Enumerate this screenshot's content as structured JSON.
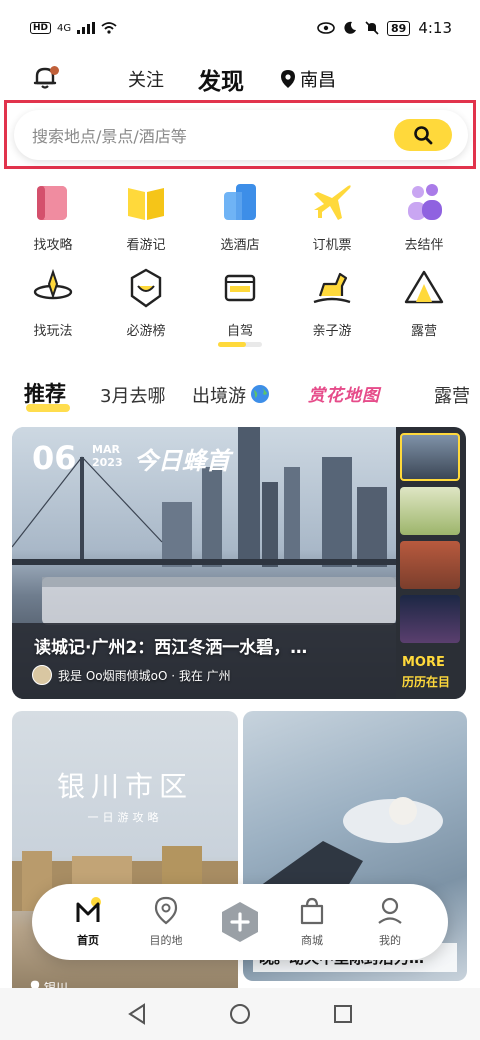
{
  "status_bar": {
    "left_label": "HD",
    "network": "4G",
    "battery": "89",
    "time": "4:13"
  },
  "header": {
    "tab_follow": "关注",
    "tab_discover": "发现",
    "location": "南昌"
  },
  "search": {
    "placeholder": "搜索地点/景点/酒店等"
  },
  "quick_entries": [
    {
      "label": "找攻略",
      "icon": "guide-book-icon"
    },
    {
      "label": "看游记",
      "icon": "travel-notes-icon"
    },
    {
      "label": "选酒店",
      "icon": "hotel-icon"
    },
    {
      "label": "订机票",
      "icon": "airplane-icon"
    },
    {
      "label": "去结伴",
      "icon": "companion-icon"
    },
    {
      "label": "找玩法",
      "icon": "play-icon"
    },
    {
      "label": "必游榜",
      "icon": "ranking-icon"
    },
    {
      "label": "自驾",
      "icon": "car-icon"
    },
    {
      "label": "亲子游",
      "icon": "rocking-horse-icon"
    },
    {
      "label": "露营",
      "icon": "tent-icon"
    }
  ],
  "category_tabs": [
    {
      "label": "推荐",
      "active": true
    },
    {
      "label": "3月去哪",
      "active": false
    },
    {
      "label": "出境游",
      "active": false
    },
    {
      "label": "赏花地图",
      "active": false
    },
    {
      "label": "露营",
      "active": false
    }
  ],
  "hero_card": {
    "day": "06",
    "month": "MAR",
    "year": "2023",
    "headline": "今日蜂首",
    "title": "读城记·广州2：西江冬洒一水碧，…",
    "author_line": "我是 Oo烟雨倾城oO · 我在 广州",
    "more_label": "MORE",
    "more_sub": "历历在目"
  },
  "card_left": {
    "title": "银川市区",
    "subtitle": "一日游攻略",
    "location": "银川"
  },
  "card_right": {
    "caption": "晚。动火中里际封冶力…"
  },
  "bottom_nav": [
    {
      "label": "首页",
      "icon": "home-icon",
      "active": true
    },
    {
      "label": "目的地",
      "icon": "location-pin-icon",
      "active": false
    },
    {
      "label": "",
      "icon": "plus-icon",
      "active": false
    },
    {
      "label": "商城",
      "icon": "shopping-bag-icon",
      "active": false
    },
    {
      "label": "我的",
      "icon": "profile-icon",
      "active": false
    }
  ],
  "colors": {
    "accent": "#ffd93b",
    "highlight_frame": "#e1334c"
  }
}
